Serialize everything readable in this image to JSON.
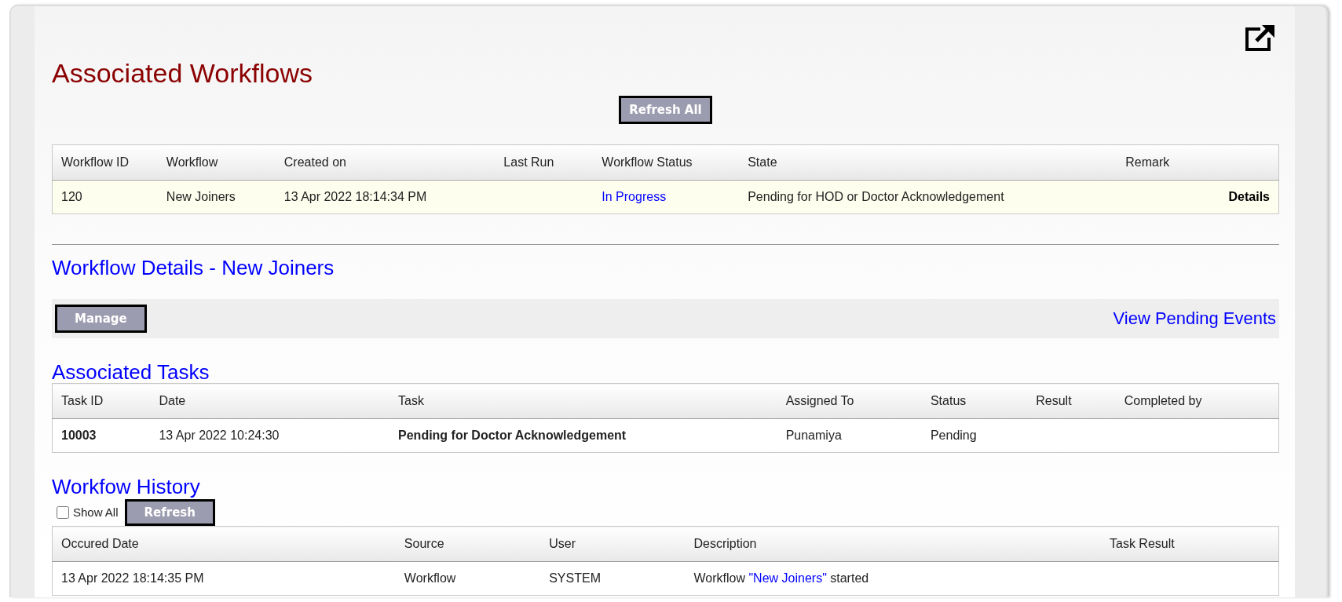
{
  "title": "Associated Workflows",
  "refresh_all_button": "Refresh All",
  "workflows_table": {
    "columns": [
      "Workflow ID",
      "Workflow",
      "Created on",
      "Last Run",
      "Workflow Status",
      "State",
      "Remark",
      ""
    ],
    "rows": [
      {
        "cells": [
          {
            "text": "120"
          },
          {
            "text": "New Joiners"
          },
          {
            "text": "13 Apr 2022 18:14:34 PM"
          },
          {
            "text": ""
          },
          {
            "text": "In Progress",
            "kind": "link"
          },
          {
            "text": "Pending for HOD or Doctor Acknowledgement"
          },
          {
            "text": ""
          },
          {
            "text": "Details",
            "kind": "action"
          }
        ]
      }
    ]
  },
  "details_title": "Workflow Details - New Joiners",
  "manage_button": "Manage",
  "view_pending_link": "View Pending Events",
  "tasks_title": "Associated Tasks",
  "tasks_table": {
    "columns": [
      "Task ID",
      "Date",
      "Task",
      "Assigned To",
      "Status",
      "Result",
      "Completed by"
    ],
    "rows": [
      {
        "cells": [
          {
            "text": "10003",
            "kind": "bold"
          },
          {
            "text": "13 Apr 2022 10:24:30"
          },
          {
            "text": "Pending for Doctor Acknowledgement",
            "kind": "bold"
          },
          {
            "text": "Punamiya"
          },
          {
            "text": "Pending"
          },
          {
            "text": ""
          },
          {
            "text": ""
          }
        ]
      }
    ]
  },
  "history_title": "Workfow History",
  "show_all": {
    "label": "Show All",
    "checked": false
  },
  "refresh_button": "Refresh",
  "history_table": {
    "columns": [
      "Occured Date",
      "Source",
      "User",
      "Description",
      "Task Result"
    ],
    "rows": [
      {
        "cells": [
          {
            "text": "13 Apr 2022 18:14:35 PM"
          },
          {
            "text": "Workflow"
          },
          {
            "text": "SYSTEM"
          },
          {
            "text": "Workflow ",
            "link": "\"New Joiners\"",
            "suffix": " started",
            "kind": "sentence"
          },
          {
            "text": ""
          }
        ]
      }
    ]
  }
}
